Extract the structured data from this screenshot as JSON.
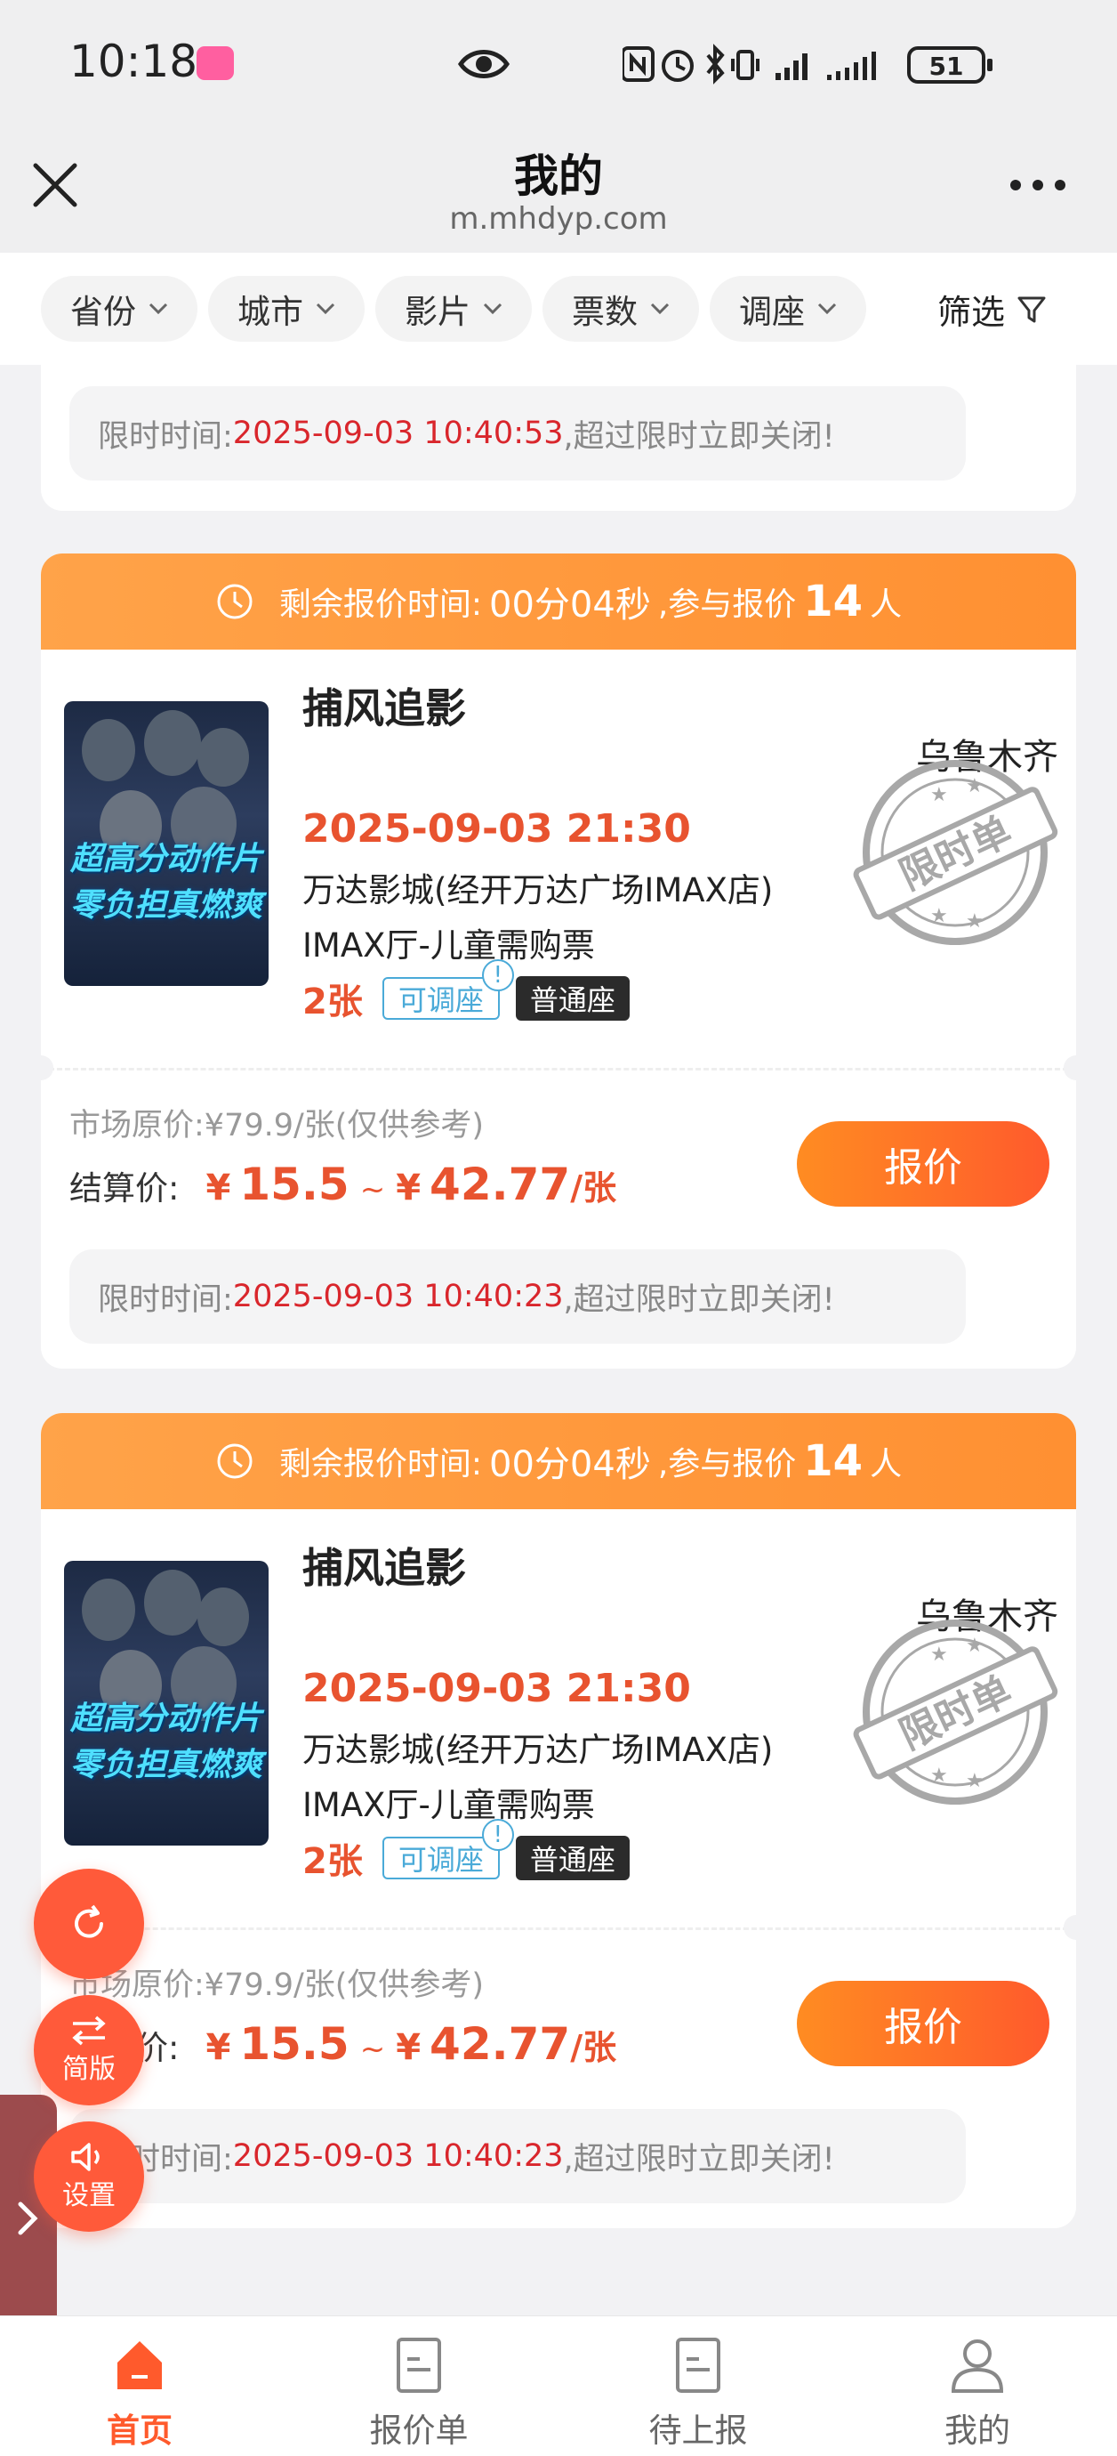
{
  "status_bar": {
    "time": "10:18",
    "battery": "51"
  },
  "header": {
    "title": "我的",
    "url": "m.mhdyp.com"
  },
  "filters": [
    {
      "label": "省份"
    },
    {
      "label": "城市"
    },
    {
      "label": "影片"
    },
    {
      "label": "票数"
    },
    {
      "label": "调座"
    }
  ],
  "filter_button": "筛选",
  "partial_card": {
    "deadline_label": "限时时间:",
    "deadline_time": "2025-09-03 10:40:53",
    "deadline_suffix": ",超过限时立即关闭!"
  },
  "cards": [
    {
      "header_label": "剩余报价时间:",
      "remaining": "00分04秒",
      "participants_label": ",参与报价",
      "participants": "14",
      "participants_unit": "人",
      "poster_line1": "超高分动作片",
      "poster_line2": "零负担真燃爽",
      "film": "捕风追影",
      "city": "乌鲁木齐",
      "stamp": "限时单",
      "showtime": "2025-09-03 21:30",
      "cinema": "万达影城(经开万达广场IMAX店)",
      "hall": "IMAX厅-儿童需购票",
      "tickets": "2张",
      "tag_adjust": "可调座",
      "tag_info": "!",
      "tag_seat": "普通座",
      "market_price": "市场原价:¥79.9/张(仅供参考)",
      "settle_label": "结算价:",
      "currency": "¥",
      "price_min": "15.5",
      "tilde": "~",
      "price_max": "42.77",
      "price_unit": "/张",
      "quote_button": "报价",
      "deadline_label": "限时时间:",
      "deadline_time": "2025-09-03 10:40:23",
      "deadline_suffix": ",超过限时立即关闭!"
    },
    {
      "header_label": "剩余报价时间:",
      "remaining": "00分04秒",
      "participants_label": ",参与报价",
      "participants": "14",
      "participants_unit": "人",
      "poster_line1": "超高分动作片",
      "poster_line2": "零负担真燃爽",
      "film": "捕风追影",
      "city": "乌鲁木齐",
      "stamp": "限时单",
      "showtime": "2025-09-03 21:30",
      "cinema": "万达影城(经开万达广场IMAX店)",
      "hall": "IMAX厅-儿童需购票",
      "tickets": "2张",
      "tag_adjust": "可调座",
      "tag_info": "!",
      "tag_seat": "普通座",
      "market_price": "市场原价:¥79.9/张(仅供参考)",
      "settle_label": "结算价:",
      "currency": "¥",
      "price_min": "15.5",
      "tilde": "~",
      "price_max": "42.77",
      "price_unit": "/张",
      "quote_button": "报价",
      "deadline_label": "限时时间:",
      "deadline_time": "2025-09-03 10:40:23",
      "deadline_suffix": ",超过限时立即关闭!"
    }
  ],
  "floating": {
    "simple_label": "简版",
    "settings_label": "设置"
  },
  "bottom_nav": [
    {
      "label": "首页",
      "icon": "home-icon",
      "active": true
    },
    {
      "label": "报价单",
      "icon": "document-icon",
      "active": false
    },
    {
      "label": "待上报",
      "icon": "document-icon",
      "active": false
    },
    {
      "label": "我的",
      "icon": "user-icon",
      "active": false
    }
  ],
  "colors": {
    "accent": "#ff5a2c",
    "header_orange": "#ff9a3c",
    "price_red": "#e8532f",
    "deadline_red": "#d9262c"
  }
}
